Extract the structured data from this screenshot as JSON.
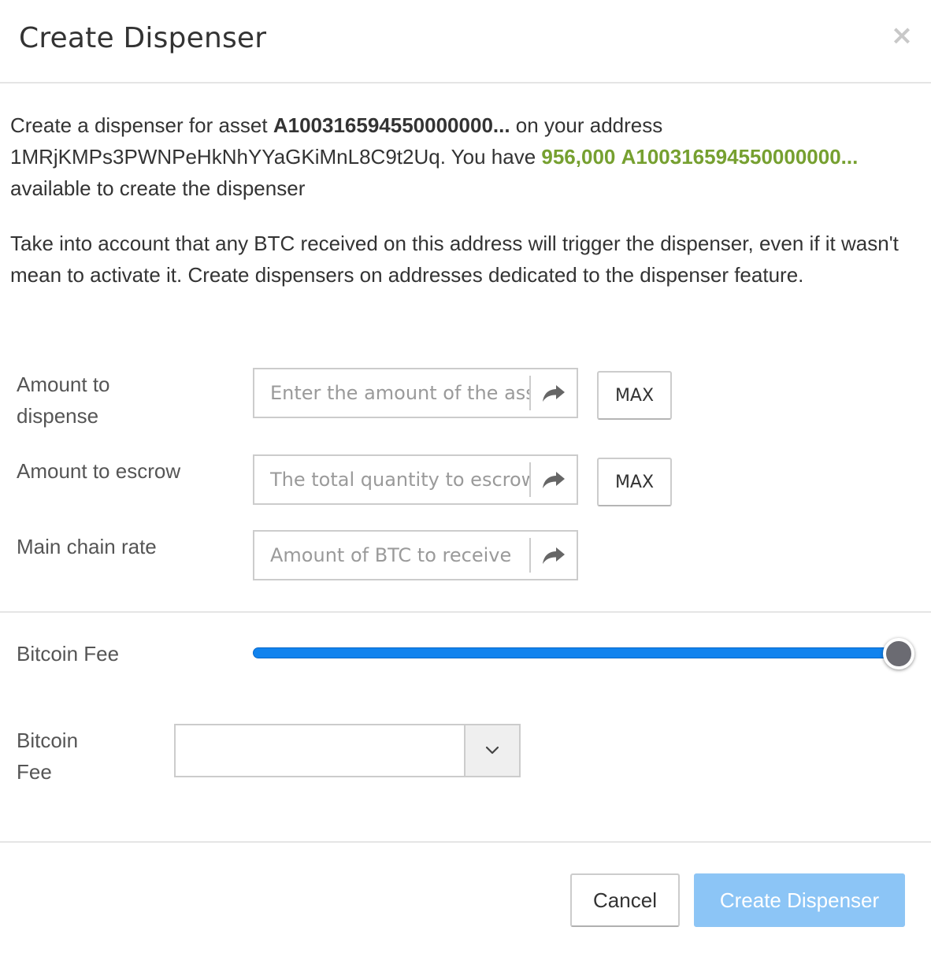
{
  "header": {
    "title": "Create Dispenser",
    "close_glyph": "×"
  },
  "description": {
    "line1_prefix": "Create a dispenser for asset ",
    "asset": "A100316594550000000...",
    "line1_mid": " on your address ",
    "address": "1MRjKMPs3PWNPeHkNhYYaGKiMnL8C9t2Uq",
    "line1_have": ". You have ",
    "available_amount": "956,000",
    "available_asset": "A100316594550000000...",
    "line1_suffix": " available to create the dispenser",
    "warning": "Take into account that any BTC received on this address will trigger the dispenser, even if it wasn't mean to activate it. Create dispensers on addresses dedicated to the dispenser feature."
  },
  "form": {
    "amount_to_dispense": {
      "label": "Amount to dispense",
      "placeholder": "Enter the amount of the asset to dispense",
      "max_label": "MAX"
    },
    "amount_to_escrow": {
      "label": "Amount to escrow",
      "placeholder": "The total quantity to escrow",
      "max_label": "MAX"
    },
    "main_chain_rate": {
      "label": "Main chain rate",
      "placeholder": "Amount of BTC to receive"
    }
  },
  "fee": {
    "slider_label": "Bitcoin Fee",
    "slider_value_fraction": 1.0,
    "select_label": "Bitcoin Fee",
    "select_value": ""
  },
  "footer": {
    "cancel_label": "Cancel",
    "create_label": "Create Dispenser"
  },
  "colors": {
    "accent": "#1183ee",
    "highlight_green": "#76a030",
    "primary_disabled": "#8cc5f6"
  },
  "icons": {
    "addon": "share-arrow-icon",
    "select": "chevron-down-icon",
    "close": "close-icon"
  }
}
